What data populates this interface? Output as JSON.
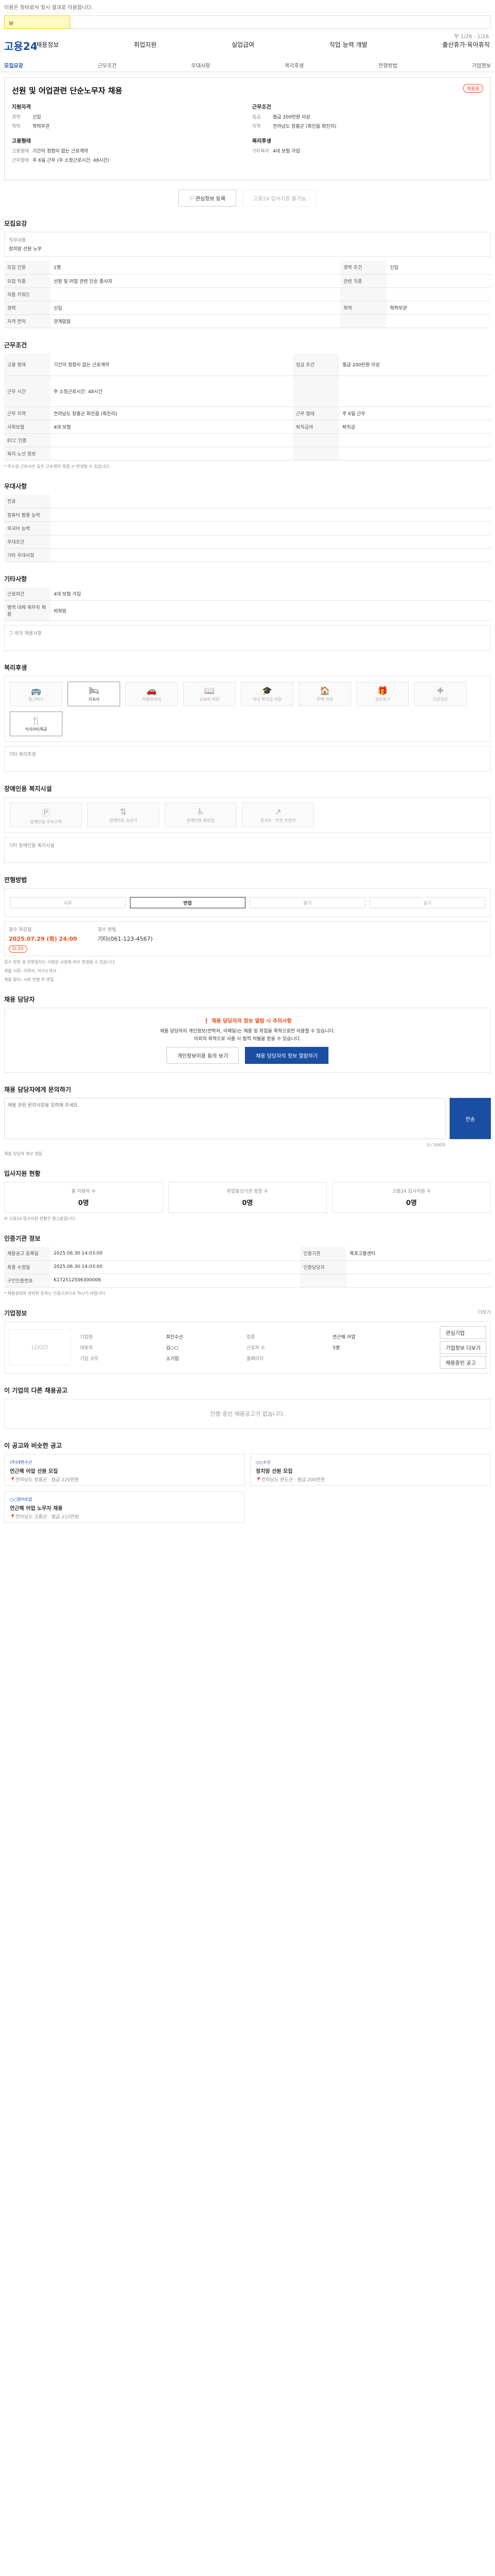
{
  "topbar": {
    "notice": "이용은 정비로서 장시 결과로 이용합니다.",
    "search_value": "보",
    "match": "부 1/26 - 1/26"
  },
  "header": {
    "logo": "고용24",
    "gnb": [
      "채용정보",
      "취업지원",
      "실업급여",
      "직업 능력 개발",
      "출산휴가·육아휴직"
    ],
    "tabs": [
      "모집요강",
      "근무조건",
      "우대사항",
      "복리후생",
      "전형방법",
      "기업정보"
    ]
  },
  "job": {
    "title": "선원 및 어업관련 단순노무자 채용",
    "status": "채용중",
    "left_title": "지원자격",
    "left_items": [
      {
        "k": "경력",
        "v": "신입"
      },
      {
        "k": "학력",
        "v": "학력무관"
      }
    ],
    "employ_title": "고용형태",
    "employ_items": [
      {
        "k": "고용형태",
        "v": "기간의 정함이 없는 근로계약"
      },
      {
        "k": "근무형태",
        "v": "주 6일 근무 (주 소정근로시간: 48시간)"
      }
    ],
    "right_title": "근무조건",
    "right_items": [
      {
        "k": "임금",
        "v": "월급 200만원 이상"
      },
      {
        "k": "지역",
        "v": "전라남도 장흥군 (회진읍 회진리)"
      }
    ],
    "welfare_title": "복리후생",
    "welfare_items": [
      {
        "k": "기타복리",
        "v": "4대 보험 가입"
      }
    ],
    "btn_interest": "관심정보 등록",
    "btn_apply": "고용24 입사지원 불가능"
  },
  "recruit": {
    "title": "모집요강",
    "duty_label": "직무내용",
    "duty_text": "정치망 선원 노무",
    "rows": [
      {
        "k": "모집 인원",
        "v": "1명",
        "k2": "경력 조건",
        "v2": "신입"
      },
      {
        "k": "모집 직종",
        "v": "선원 및 어업 관련 단순 종사자",
        "k2": "관련 직종",
        "v2": ""
      },
      {
        "k": "직종 키워드",
        "v": "",
        "k2": "",
        "v2": ""
      },
      {
        "k": "경력",
        "v": "신입",
        "k2": "학력",
        "v2": "학력무관"
      },
      {
        "k": "자격 면허",
        "v": "관계없음",
        "k2": "",
        "v2": ""
      }
    ]
  },
  "cond": {
    "title": "근무조건",
    "rows": [
      {
        "k": "고용 형태",
        "v": "기간의 정함이 없는 근로계약",
        "k2": "임금 조건",
        "v2": "월급 200만원 이상"
      },
      {
        "k": "근무 시간",
        "v": "주 소정근로시간: 48시간",
        "k2": "",
        "v2": ""
      },
      {
        "k": "근무 지역",
        "v": "전라남도 장흥군 회진읍 (회진리)",
        "k2": "근무 형태",
        "v2": "주 6일 근무"
      },
      {
        "k": "사회보험",
        "v": "4대 보험",
        "k2": "퇴직급여",
        "v2": "퇴직금"
      },
      {
        "k": "ECC 인증",
        "v": "",
        "k2": "",
        "v2": ""
      },
      {
        "k": "복지 노선 정보",
        "v": "",
        "k2": "",
        "v2": ""
      }
    ],
    "note": "* 주소정 근로시간 등은 근로계약 체결 시 변경될 수 있습니다."
  },
  "prefer": {
    "title": "우대사항",
    "rows": [
      {
        "k": "전공",
        "v": ""
      },
      {
        "k": "컴퓨터 활용 능력",
        "v": ""
      },
      {
        "k": "외국어 능력",
        "v": ""
      },
      {
        "k": "우대조건",
        "v": ""
      },
      {
        "k": "기타 우대사항",
        "v": ""
      }
    ]
  },
  "etc": {
    "title": "기타사항",
    "rows": [
      {
        "k": "근로여건",
        "v": "4대 보험 가입"
      },
      {
        "k": "병역 대체 복무자 채용",
        "v": "비희망"
      }
    ],
    "sub": "그 외의 채용사항"
  },
  "welfare": {
    "title": "복리후생",
    "items": [
      {
        "name": "통근버스",
        "glyph": "🚌",
        "on": false
      },
      {
        "name": "기숙사",
        "glyph": "🛏",
        "on": true
      },
      {
        "name": "차량유지비",
        "glyph": "🚗",
        "on": false
      },
      {
        "name": "교육비 지원",
        "glyph": "📖",
        "on": false
      },
      {
        "name": "자녀 학자금 지원",
        "glyph": "🎓",
        "on": false
      },
      {
        "name": "주택 지원",
        "glyph": "🏠",
        "on": false
      },
      {
        "name": "경조휴가",
        "glyph": "🎁",
        "on": false
      },
      {
        "name": "건강검진",
        "glyph": "✚",
        "on": false
      },
      {
        "name": "식사(비)제공",
        "glyph": "🍴",
        "on": true
      }
    ],
    "sub": "기타 복리후생"
  },
  "disabled": {
    "title": "장애인용 복지시설",
    "items": [
      {
        "name": "장애인용 주차구역",
        "glyph": "Ⓟ"
      },
      {
        "name": "장애인용 승강기",
        "glyph": "⇅"
      },
      {
        "name": "장애인용 화장실",
        "glyph": "♿"
      },
      {
        "name": "경사로 · 안전 손잡이",
        "glyph": "↗"
      }
    ],
    "sub": "기타 장애인용 복지시설"
  },
  "process": {
    "title": "전형방법",
    "steps": [
      "서류",
      "면접",
      "필기",
      "실기"
    ],
    "active": "면접",
    "date_label": "접수 마감일",
    "date_value": "2025.07.29 (화) 24:00",
    "date_badge": "D-20",
    "method_label": "접수 방법",
    "method_value": "기타(061-123-4567)",
    "notes": [
      "접수 방법 및 전형절차는 사업장 사정에 따라 변경될 수 있습니다.",
      "제출 서류: 이력서, 자기소개서",
      "채용 절차: 서류 전형 후 면접"
    ]
  },
  "contact": {
    "title": "채용 담당자",
    "warn": "❗ 채용 담당자의 정보 열람 시 주의사항",
    "text": "채용 담당자의 개인정보(연락처, 이메일)는 채용 및 취업을 목적으로만 이용할 수 있습니다.",
    "text2": "이외의 목적으로 사용 시 법적 처벌을 받을 수 있습니다.",
    "btn_a": "개인정보이용 동의 보기",
    "btn_b": "채용 담당자의 정보 열람하기"
  },
  "inquiry": {
    "title": "채용 담당자에게 문의하기",
    "placeholder": "채용 관련 문의사항을 입력해 주세요.",
    "count": "0 / 500자",
    "btn": "전송",
    "link": "채용 담당자 정보 열람"
  },
  "apply": {
    "title": "입사지원 현황",
    "stats": [
      {
        "label": "총 지원자 수",
        "value": "0명"
      },
      {
        "label": "취업알선기관 방문 수",
        "value": "0명"
      },
      {
        "label": "고용24 입사지원 수",
        "value": "0명"
      }
    ],
    "note": "※ 고용24 입사지원 현황은 참고용입니다."
  },
  "mgmt": {
    "title": "인증기관 정보",
    "rows": [
      {
        "k": "채용공고 등록일",
        "v": "2025.06.30 14:03:00",
        "k2": "인증기관",
        "v2": "목포고용센터"
      },
      {
        "k": "최종 수정일",
        "v": "2025.06.30 14:03:00",
        "k2": "인증담당자",
        "v2": ""
      },
      {
        "k": "구인인증번호",
        "v": "K172512506300006",
        "k2": "",
        "v2": ""
      }
    ],
    "note": "* 채용정보와 관련된 문의는 인증기관으로 하시기 바랍니다."
  },
  "company": {
    "title": "기업정보",
    "more": "더보기",
    "logo_alt": "LOGO",
    "rows": [
      {
        "k": "기업명",
        "v": "회진수산",
        "k2": "업종",
        "v2": "연근해 어업"
      },
      {
        "k": "대표자",
        "v": "김○○",
        "k2": "근로자 수",
        "v2": "5명"
      },
      {
        "k": "기업 규모",
        "v": "소기업",
        "k2": "홈페이지",
        "v2": ""
      }
    ],
    "btn_a": "관심기업",
    "btn_b": "기업정보 더보기",
    "btn_c": "채용중인 공고"
  },
  "others": {
    "title": "이 기업의 다른 채용공고",
    "empty": "진행 중인 채용공고가 없습니다."
  },
  "similar": {
    "title": "이 공고와 비슷한 공고",
    "cards": [
      {
        "company": "(주)대한수산",
        "title": "연근해 어업 선원 모집",
        "loc": "전라남도 장흥군",
        "pay": "월급 220만원"
      },
      {
        "company": "○○수산",
        "title": "정치망 선원 모집",
        "loc": "전라남도 완도군",
        "pay": "월급 200만원"
      },
      {
        "company": "○○영어조합",
        "title": "연근해 어업 노무자 채용",
        "loc": "전라남도 고흥군",
        "pay": "월급 210만원"
      }
    ]
  }
}
